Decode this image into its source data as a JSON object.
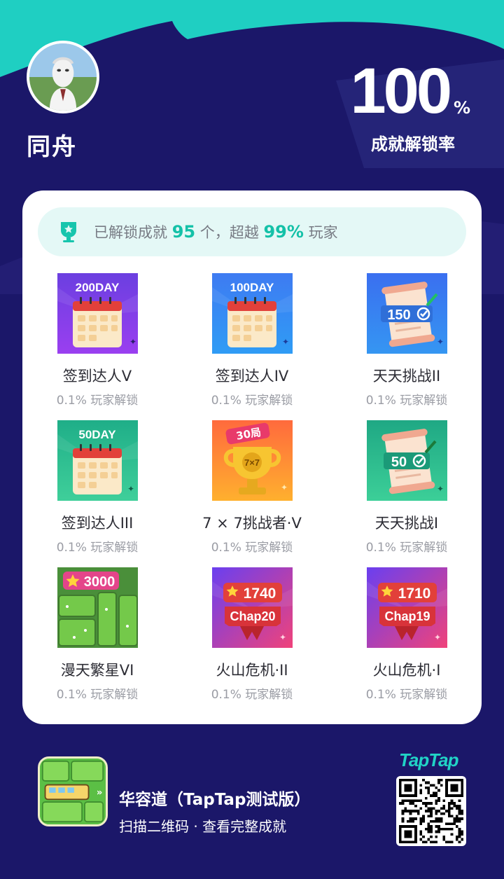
{
  "profile": {
    "username": "同舟",
    "unlock_rate": "100",
    "unlock_rate_unit": "%",
    "unlock_rate_label": "成就解锁率"
  },
  "summary": {
    "prefix": "已解锁成就",
    "count": "95",
    "middle": "个，超越",
    "percent": "99%",
    "suffix": "玩家"
  },
  "achievements": [
    {
      "name": "签到达人V",
      "rate": "0.1% 玩家解锁",
      "badge": "200DAY",
      "icon": "calendar-badge-icon",
      "theme": "purple"
    },
    {
      "name": "签到达人IV",
      "rate": "0.1% 玩家解锁",
      "badge": "100DAY",
      "icon": "calendar-badge-icon",
      "theme": "blue"
    },
    {
      "name": "天天挑战II",
      "rate": "0.1% 玩家解锁",
      "badge": "150",
      "icon": "scroll-check-icon",
      "theme": "blue"
    },
    {
      "name": "签到达人III",
      "rate": "0.1% 玩家解锁",
      "badge": "50DAY",
      "icon": "calendar-badge-icon",
      "theme": "green"
    },
    {
      "name": "7 × 7挑战者·V",
      "rate": "0.1% 玩家解锁",
      "badge": "30局",
      "badge2": "7×7",
      "icon": "trophy-badge-icon",
      "theme": "orange"
    },
    {
      "name": "天天挑战I",
      "rate": "0.1% 玩家解锁",
      "badge": "50",
      "icon": "scroll-check-icon",
      "theme": "green"
    },
    {
      "name": "漫天繁星VI",
      "rate": "0.1% 玩家解锁",
      "badge": "3000",
      "icon": "grass-tiles-icon",
      "theme": "grass"
    },
    {
      "name": "火山危机·II",
      "rate": "0.1% 玩家解锁",
      "badge": "1740",
      "badge2": "Chap20",
      "icon": "ribbon-badge-icon",
      "theme": "red"
    },
    {
      "name": "火山危机·I",
      "rate": "0.1% 玩家解锁",
      "badge": "1710",
      "badge2": "Chap19",
      "icon": "ribbon-badge-icon",
      "theme": "red"
    }
  ],
  "footer": {
    "game_title": "华容道（TapTap测试版）",
    "hint": "扫描二维码 · 查看完整成就",
    "brand": "TapTap"
  },
  "colors": {
    "background": "#1b1769",
    "accent_teal": "#21d3c6",
    "highlight": "#14c1a8"
  }
}
